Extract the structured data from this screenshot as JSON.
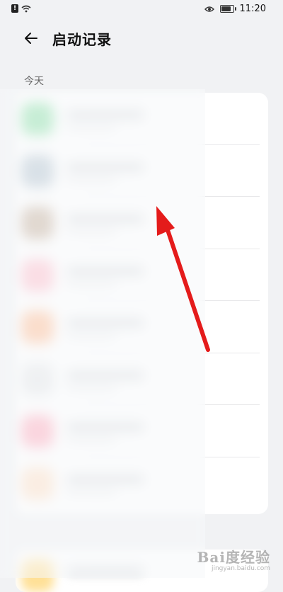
{
  "status_bar": {
    "time": "11:20",
    "battery_level": 0.8,
    "icons": [
      "alert-icon",
      "wifi-icon",
      "eye-icon",
      "battery-icon"
    ]
  },
  "header": {
    "title": "启动记录",
    "back_icon": "arrow-left-icon"
  },
  "section": {
    "label": "今天"
  },
  "list": {
    "items": [
      {
        "icon_color": "#4fd07a",
        "name": ""
      },
      {
        "icon_color": "#8ea6b8",
        "name": ""
      },
      {
        "icon_color": "#a9886a",
        "name": ""
      },
      {
        "icon_color": "#ff9bb0",
        "name": ""
      },
      {
        "icon_color": "#ff9a5c",
        "name": ""
      },
      {
        "icon_color": "#d9dbde",
        "name": ""
      },
      {
        "icon_color": "#ff7f9a",
        "name": ""
      },
      {
        "icon_color": "#ffd0a8",
        "name": ""
      }
    ],
    "extra_item": {
      "icon_color": "#ffd060",
      "name": ""
    }
  },
  "annotation": {
    "color": "#e41b1b"
  },
  "watermark": {
    "main": "Bai度经验",
    "url": "jingyan.baidu.com"
  }
}
